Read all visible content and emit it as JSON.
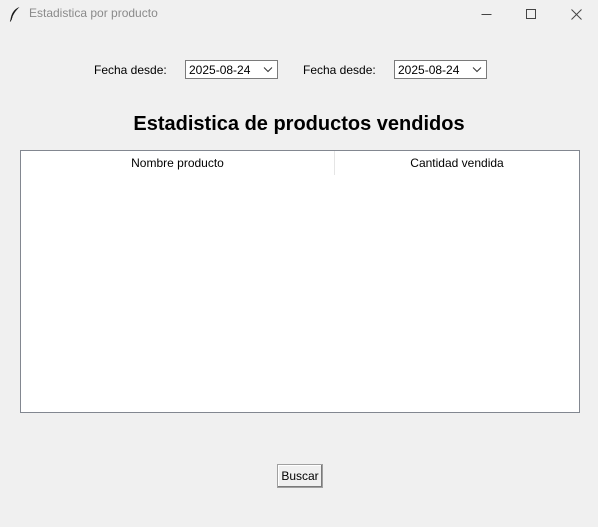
{
  "window": {
    "title": "Estadistica por producto",
    "icon": "feather-icon"
  },
  "filters": {
    "from_label": "Fecha desde:",
    "from_value": "2025-08-24",
    "to_label": "Fecha desde:",
    "to_value": "2025-08-24"
  },
  "heading": "Estadistica de productos vendidos",
  "table": {
    "columns": [
      "Nombre producto",
      "Cantidad vendida"
    ],
    "rows": []
  },
  "actions": {
    "search_label": "Buscar"
  }
}
